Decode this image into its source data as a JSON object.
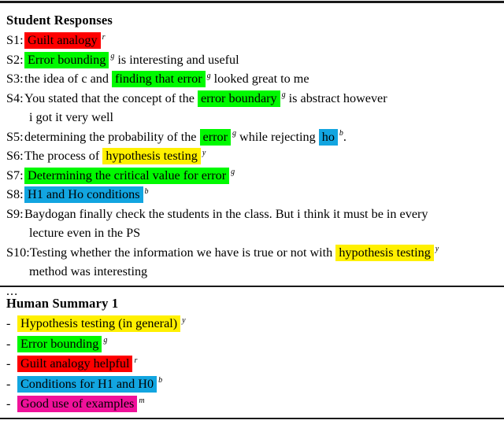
{
  "document": {
    "rules": {
      "top": "thick-rule",
      "middle": "thin-rule",
      "bottom": "thin-rule"
    },
    "highlight_colors": {
      "r": "#fe0000",
      "g": "#00f900",
      "y": "#fff000",
      "b": "#12a5e0",
      "m": "#f0119a"
    }
  },
  "responses": {
    "title": "Student Responses",
    "items": [
      {
        "tag": "S1:",
        "segments": [
          {
            "text": "Guilt analogy",
            "highlight": "r",
            "mark": "r"
          }
        ]
      },
      {
        "tag": "S2:",
        "segments": [
          {
            "text": "Error bounding",
            "highlight": "g",
            "mark": "g"
          },
          {
            "text": " is interesting and useful",
            "highlight": "",
            "mark": ""
          }
        ]
      },
      {
        "tag": "S3:",
        "segments": [
          {
            "text": "the idea of c and ",
            "highlight": "",
            "mark": ""
          },
          {
            "text": "finding that error",
            "highlight": "g",
            "mark": "g"
          },
          {
            "text": " looked great to me",
            "highlight": "",
            "mark": ""
          }
        ]
      },
      {
        "tag": "S4:",
        "segments": [
          {
            "text": "You stated that the concept of the ",
            "highlight": "",
            "mark": ""
          },
          {
            "text": "error boundary",
            "highlight": "g",
            "mark": "g"
          },
          {
            "text": " is abstract however",
            "highlight": "",
            "mark": ""
          }
        ],
        "continuation": "i got it very well"
      },
      {
        "tag": "S5:",
        "segments": [
          {
            "text": "determining the probability of the ",
            "highlight": "",
            "mark": ""
          },
          {
            "text": "error",
            "highlight": "g",
            "mark": "g"
          },
          {
            "text": " while rejecting ",
            "highlight": "",
            "mark": ""
          },
          {
            "text": "ho",
            "highlight": "b",
            "mark": "b"
          },
          {
            "text": ".",
            "highlight": "",
            "mark": ""
          }
        ]
      },
      {
        "tag": "S6:",
        "segments": [
          {
            "text": "The process of ",
            "highlight": "",
            "mark": ""
          },
          {
            "text": "hypothesis testing",
            "highlight": "y",
            "mark": "y"
          }
        ]
      },
      {
        "tag": "S7:",
        "segments": [
          {
            "text": "Determining the critical value for error",
            "highlight": "g",
            "mark": "g"
          }
        ]
      },
      {
        "tag": "S8:",
        "segments": [
          {
            "text": "H1 and Ho conditions",
            "highlight": "b",
            "mark": "b"
          }
        ]
      },
      {
        "tag": "S9:",
        "segments": [
          {
            "text": "Baydogan finally check the students in the class. But i think it must be in every",
            "highlight": "",
            "mark": ""
          }
        ],
        "continuation": "lecture even in the PS"
      },
      {
        "tag": "S10:",
        "segments": [
          {
            "text": "Testing whether the information we have is true or not with ",
            "highlight": "",
            "mark": ""
          },
          {
            "text": "hypothesis testing",
            "highlight": "y",
            "mark": "y"
          }
        ],
        "continuation": "method was interesting"
      }
    ],
    "ellipsis": "..."
  },
  "summary": {
    "title": "Human Summary 1",
    "bullet": "-",
    "items": [
      {
        "text": "Hypothesis testing (in general)",
        "highlight": "y",
        "mark": "y"
      },
      {
        "text": "Error bounding",
        "highlight": "g",
        "mark": "g"
      },
      {
        "text": "Guilt analogy helpful",
        "highlight": "r",
        "mark": "r"
      },
      {
        "text": "Conditions for H1 and H0",
        "highlight": "b",
        "mark": "b"
      },
      {
        "text": "Good use of examples",
        "highlight": "m",
        "mark": "m"
      }
    ]
  }
}
